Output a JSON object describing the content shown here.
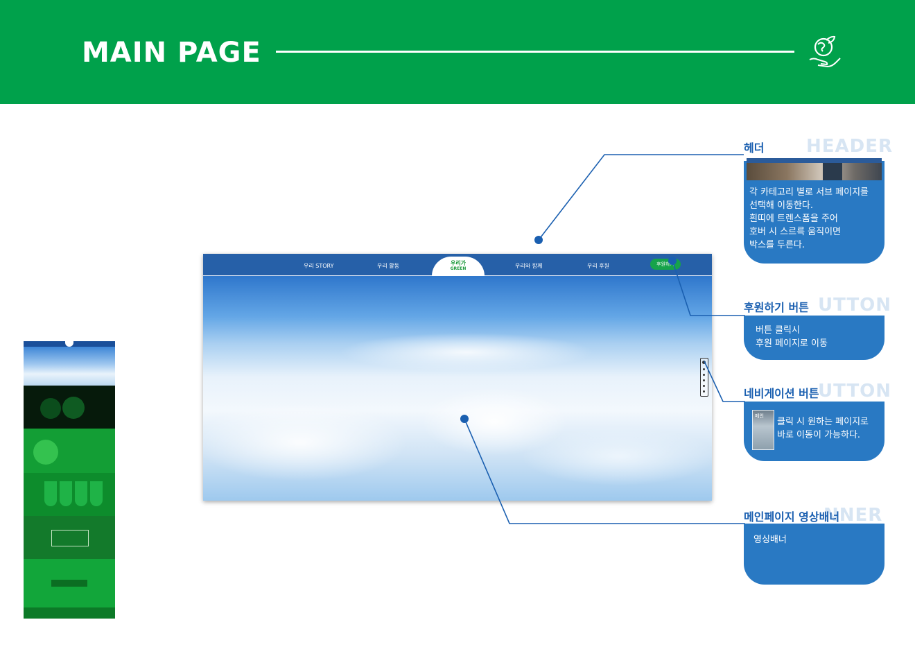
{
  "header": {
    "title": "MAIN PAGE"
  },
  "mockup": {
    "nav": {
      "items": [
        "우리 STORY",
        "우리 활동",
        "우리와 함께",
        "우리 후원"
      ],
      "logo_line1": "우리가",
      "logo_line2": "GREEN",
      "donate_label": "후원하기"
    }
  },
  "annotations": {
    "header": {
      "title": "헤더",
      "ghost": "HEADER",
      "text": "각 카테고리 별로 서브 페이지를\n선택해 이동한다.\n흰띠에 트렌스폼을 주어\n호버 시 스르륵 움직이면\n박스를 두른다."
    },
    "donate": {
      "title": "후원하기 버튼",
      "ghost": "UTTON",
      "text": "버튼 클릭시\n후원 페이지로 이동"
    },
    "navigation": {
      "title": "네비게이션 버튼",
      "ghost": "UTTON",
      "text": "클릭 시 원하는 페이지로\n바로 이동이 가능하다.",
      "thumb_label": "메인"
    },
    "banner": {
      "title": "메인페이지 영상배너",
      "ghost": "NNER",
      "text": "영싱배너"
    }
  },
  "colors": {
    "brand_green": "#00a14b",
    "nav_blue": "#2660a8",
    "card_blue": "#2979c3",
    "title_blue": "#1a5fb0",
    "donate_green": "#16a34a"
  }
}
